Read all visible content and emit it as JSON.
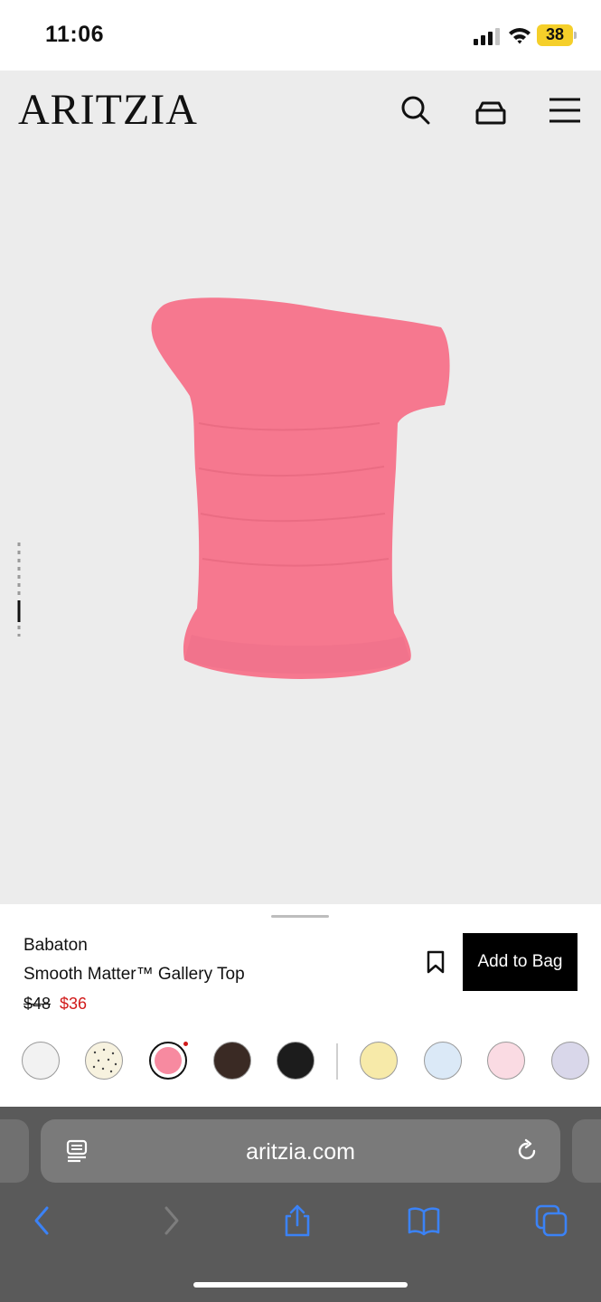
{
  "status_bar": {
    "time": "11:06",
    "battery_level": "38",
    "battery_color": "#f5cf2a"
  },
  "header": {
    "logo": "ARITZIA",
    "icons": [
      "search-icon",
      "shopping-bag-icon",
      "menu-icon"
    ]
  },
  "product": {
    "brand": "Babaton",
    "name": "Smooth Matter™ Gallery Top",
    "original_price": "$48",
    "sale_price": "$36",
    "sale_color": "#d11a1a",
    "add_to_bag_label": "Add to Bag",
    "garment_color": "#f6788f",
    "image_index": 2,
    "image_count": 2,
    "swatches": [
      {
        "color": "#f2f2f2",
        "pattern": "solid",
        "selected": false
      },
      {
        "color": "#f7f2df",
        "pattern": "dotted",
        "selected": false
      },
      {
        "color": "#f78aa0",
        "pattern": "solid",
        "selected": true
      },
      {
        "color": "#3a2a24",
        "pattern": "solid",
        "selected": false
      },
      {
        "color": "#1c1c1c",
        "pattern": "solid",
        "selected": false
      },
      {
        "color": "#f7eaa9",
        "pattern": "solid",
        "selected": false
      },
      {
        "color": "#dbe9f7",
        "pattern": "solid",
        "selected": false
      },
      {
        "color": "#fadbe3",
        "pattern": "solid",
        "selected": false
      },
      {
        "color": "#d9d7ea",
        "pattern": "solid",
        "selected": false
      }
    ]
  },
  "browser": {
    "url": "aritzia.com",
    "accent": "#3b82f6",
    "icons": [
      "page-settings-icon",
      "reload-icon",
      "back-icon",
      "forward-icon",
      "share-icon",
      "bookmarks-icon",
      "tabs-icon"
    ]
  }
}
